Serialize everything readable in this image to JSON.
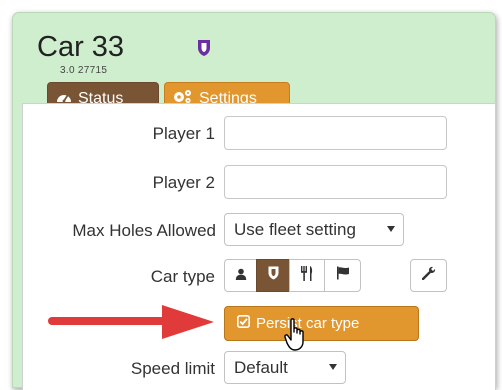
{
  "header": {
    "title": "Car 33",
    "subtitle": "3.0  27715",
    "badge_icon": "shield-icon",
    "badge_color": "#6b2fa3"
  },
  "tabs": [
    {
      "label": "Status",
      "icon": "dashboard-icon"
    },
    {
      "label": "Settings",
      "icon": "gears-icon"
    }
  ],
  "form": {
    "player1": {
      "label": "Player 1",
      "value": ""
    },
    "player2": {
      "label": "Player 2",
      "value": ""
    },
    "max_holes": {
      "label": "Max Holes Allowed",
      "value": "Use fleet setting"
    },
    "car_type": {
      "label": "Car type",
      "options": [
        "user-icon",
        "shield-icon",
        "fork-knife-icon",
        "flag-icon",
        "wrench-icon"
      ],
      "selected_index": 1
    },
    "persist_button": {
      "label": "Persist car type",
      "icon": "check-square-icon"
    },
    "speed_limit": {
      "label": "Speed limit",
      "value": "Default"
    }
  },
  "colors": {
    "header_bg": "#cfeece",
    "tab_status": "#7a5535",
    "tab_settings": "#e1962e",
    "accent_orange": "#e1962e",
    "arrow_red": "#e03a3a"
  }
}
